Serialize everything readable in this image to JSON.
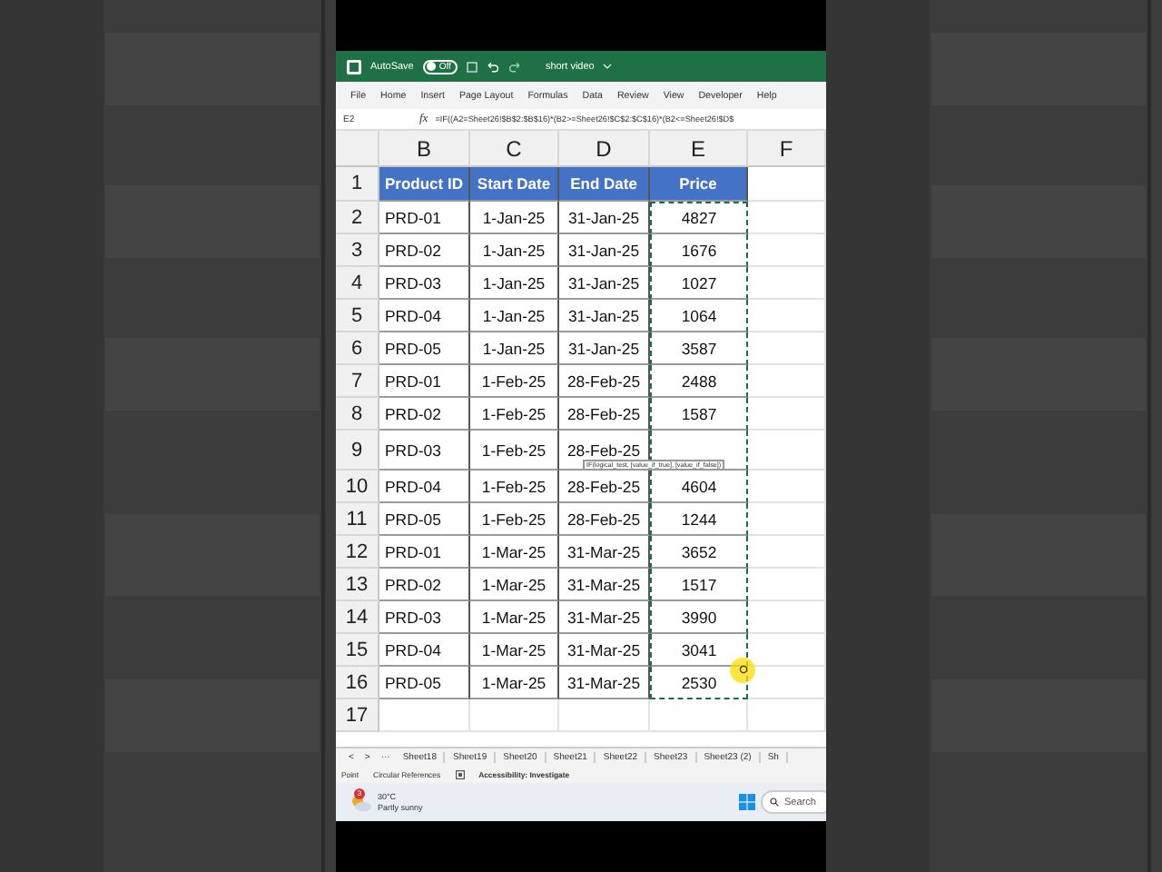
{
  "title_bar": {
    "autosave_label": "AutoSave",
    "autosave_state": "Off",
    "autosave_on": false,
    "document_title": "short video"
  },
  "menu": [
    "File",
    "Home",
    "Insert",
    "Page Layout",
    "Formulas",
    "Data",
    "Review",
    "View",
    "Developer",
    "Help"
  ],
  "formula_bar": {
    "name_box": "E2",
    "fx": "fx",
    "formula": "=IF((A2=Sheet26!$B$2:$B$16)*(B2>=Sheet26!$C$2:$C$16)*(B2<=Sheet26!$D$"
  },
  "columns": [
    "B",
    "C",
    "D",
    "E",
    "F"
  ],
  "header_row": {
    "number": "1",
    "cells": [
      "Product ID",
      "Start Date",
      "End Date",
      "Price"
    ]
  },
  "rows": [
    {
      "number": "2",
      "cells": [
        "PRD-01",
        "1-Jan-25",
        "31-Jan-25",
        "4827"
      ]
    },
    {
      "number": "3",
      "cells": [
        "PRD-02",
        "1-Jan-25",
        "31-Jan-25",
        "1676"
      ]
    },
    {
      "number": "4",
      "cells": [
        "PRD-03",
        "1-Jan-25",
        "31-Jan-25",
        "1027"
      ]
    },
    {
      "number": "5",
      "cells": [
        "PRD-04",
        "1-Jan-25",
        "31-Jan-25",
        "1064"
      ]
    },
    {
      "number": "6",
      "cells": [
        "PRD-05",
        "1-Jan-25",
        "31-Jan-25",
        "3587"
      ]
    },
    {
      "number": "7",
      "cells": [
        "PRD-01",
        "1-Feb-25",
        "28-Feb-25",
        "2488"
      ]
    },
    {
      "number": "8",
      "cells": [
        "PRD-02",
        "1-Feb-25",
        "28-Feb-25",
        "1587"
      ]
    },
    {
      "number": "9",
      "cells": [
        "PRD-03",
        "1-Feb-25",
        "28-Feb-25"
      ],
      "tooltip": "IF(logical_test, [value_if_true], [value_if_false])"
    },
    {
      "number": "10",
      "cells": [
        "PRD-04",
        "1-Feb-25",
        "28-Feb-25",
        "4604"
      ]
    },
    {
      "number": "11",
      "cells": [
        "PRD-05",
        "1-Feb-25",
        "28-Feb-25",
        "1244"
      ]
    },
    {
      "number": "12",
      "cells": [
        "PRD-01",
        "1-Mar-25",
        "31-Mar-25",
        "3652"
      ]
    },
    {
      "number": "13",
      "cells": [
        "PRD-02",
        "1-Mar-25",
        "31-Mar-25",
        "1517"
      ]
    },
    {
      "number": "14",
      "cells": [
        "PRD-03",
        "1-Mar-25",
        "31-Mar-25",
        "3990"
      ]
    },
    {
      "number": "15",
      "cells": [
        "PRD-04",
        "1-Mar-25",
        "31-Mar-25",
        "3041"
      ]
    },
    {
      "number": "16",
      "cells": [
        "PRD-05",
        "1-Mar-25",
        "31-Mar-25",
        "2530"
      ],
      "cursor": true
    }
  ],
  "empty_rows": [
    "17"
  ],
  "copy_marquee": true,
  "sheet_nav": [
    "<",
    ">",
    "···"
  ],
  "sheet_tabs": [
    "Sheet18",
    "Sheet19",
    "Sheet20",
    "Sheet21",
    "Sheet22",
    "Sheet23",
    "Sheet23 (2)",
    "Sh"
  ],
  "status_bar": {
    "mode": "Point",
    "circular": "Circular References",
    "accessibility": "Accessibility: Investigate"
  },
  "taskbar": {
    "badge": "3",
    "temperature": "30°C",
    "weather": "Partly sunny",
    "search_placeholder": "Search"
  }
}
